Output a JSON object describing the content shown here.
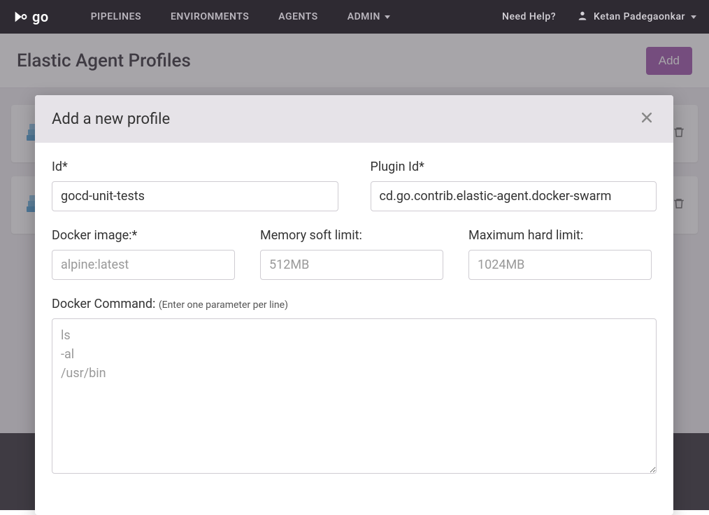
{
  "nav": {
    "logo_text": "go",
    "pipelines": "PIPELINES",
    "environments": "ENVIRONMENTS",
    "agents": "AGENTS",
    "admin": "ADMIN",
    "need_help": "Need Help?",
    "user_name": "Ketan Padegaonkar"
  },
  "page": {
    "title": "Elastic Agent Profiles",
    "add_button": "Add"
  },
  "modal": {
    "title": "Add a new profile",
    "fields": {
      "id_label": "Id*",
      "id_value": "gocd-unit-tests",
      "plugin_id_label": "Plugin Id*",
      "plugin_id_value": "cd.go.contrib.elastic-agent.docker-swarm",
      "docker_image_label": "Docker image:*",
      "docker_image_placeholder": "alpine:latest",
      "docker_image_value": "",
      "memory_soft_label": "Memory soft limit:",
      "memory_soft_placeholder": "512MB",
      "memory_soft_value": "",
      "memory_hard_label": "Maximum hard limit:",
      "memory_hard_placeholder": "1024MB",
      "memory_hard_value": "",
      "docker_command_label_main": "Docker Command: ",
      "docker_command_label_hint": "(Enter one parameter per line)",
      "docker_command_placeholder": "ls\n-al\n/usr/bin",
      "docker_command_value": ""
    }
  }
}
